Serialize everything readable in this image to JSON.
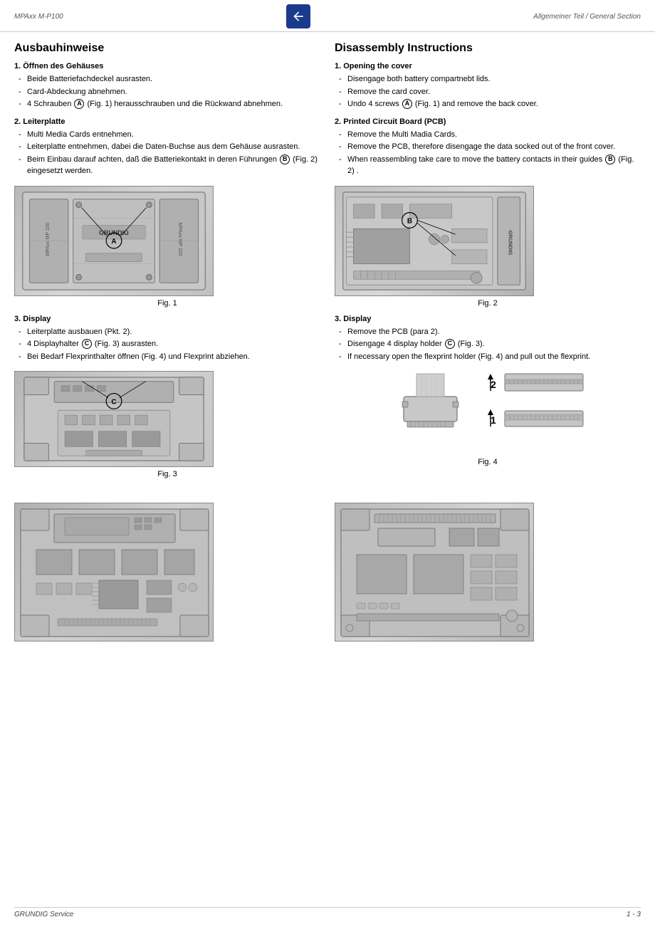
{
  "header": {
    "left": "MPAxx M-P100",
    "right": "Allgemeiner Teil / General Section",
    "icon_label": "back-arrow"
  },
  "footer": {
    "left": "GRUNDIG Service",
    "right": "1 - 3"
  },
  "left": {
    "section_title": "Ausbauhinweise",
    "sub1_title": "1. Öffnen des Gehäuses",
    "sub1_items": [
      "Beide Batteriefachdeckel ausrasten.",
      "Card-Abdeckung abnehmen.",
      "4 Schrauben ␀0 (Fig. 1) herausschrauben und die Rückwand abnehmen."
    ],
    "sub2_title": "2. Leiterplatte",
    "sub2_items": [
      "Multi Media Cards entnehmen.",
      "Leiterplatte entnehmen, dabei die Daten-Buchse aus dem Gehäuse ausrasten.",
      "Beim Einbau darauf achten, daß die Batteriekontakt in deren Führungen ␀1 (Fig. 2) eingesetzt werden."
    ],
    "fig1_label": "Fig. 1",
    "sub3_title": "3. Display",
    "sub3_items": [
      "Leiterplatte ausbauen (Pkt. 2).",
      "4 Displayhalter ␀2 (Fig. 3) ausrasten.",
      "Bei Bedarf Flexprinthalter öffnen (Fig. 4) und Flexprint abziehen."
    ],
    "fig3_label": "Fig. 3"
  },
  "right": {
    "section_title": "Disassembly Instructions",
    "sub1_title": "1. Opening the cover",
    "sub1_items": [
      "Disengage both battery compartnebt lids.",
      "Remove the card cover.",
      "Undo 4 screws ① (Fig. 1) and remove the back cover."
    ],
    "sub2_title": "2. Printed Circuit Board (PCB)",
    "sub2_items": [
      "Remove the Multi Madia Cards.",
      "Remove the PCB, therefore disengage the data socked out of the front cover.",
      "When reassembling take care to move the battery contacts in their guides ② (Fig. 2) ."
    ],
    "fig2_label": "Fig. 2",
    "sub3_title": "3. Display",
    "sub3_items": [
      "Remove the PCB (para 2).",
      "Disengage 4 display holder ③ (Fig. 3).",
      "If necessary open the flexprint holder (Fig. 4) and pull out the flexprint."
    ],
    "fig4_label": "Fig. 4"
  },
  "annotations": {
    "A": "A",
    "B": "B",
    "C": "C"
  }
}
